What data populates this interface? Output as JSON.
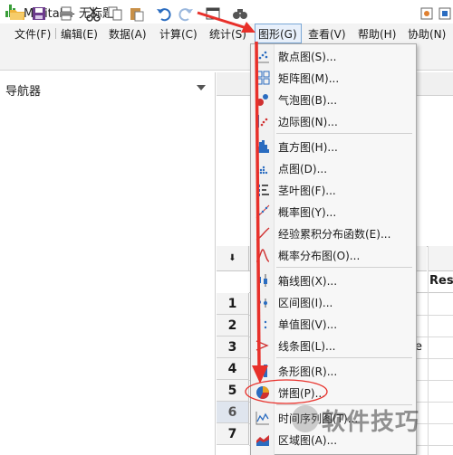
{
  "window": {
    "title": "Minitab - 无标题"
  },
  "menubar": {
    "items": [
      "文件(F)",
      "编辑(E)",
      "数据(A)",
      "计算(C)",
      "统计(S)",
      "图形(G)",
      "查看(V)",
      "帮助(H)",
      "协助(N)"
    ]
  },
  "navigator": {
    "title": "导航器"
  },
  "graph_menu": {
    "items": [
      {
        "label": "散点图(S)...",
        "icon": "scatterplot-icon"
      },
      {
        "label": "矩阵图(M)...",
        "icon": "matrix-plot-icon"
      },
      {
        "label": "气泡图(B)...",
        "icon": "bubble-plot-icon"
      },
      {
        "label": "边际图(N)...",
        "icon": "marginal-plot-icon"
      },
      {
        "label": "直方图(H)...",
        "icon": "histogram-icon"
      },
      {
        "label": "点图(D)...",
        "icon": "dotplot-icon"
      },
      {
        "label": "茎叶图(F)...",
        "icon": "stem-leaf-icon"
      },
      {
        "label": "概率图(Y)...",
        "icon": "probability-plot-icon"
      },
      {
        "label": "经验累积分布函数(E)...",
        "icon": "ecdf-icon"
      },
      {
        "label": "概率分布图(O)...",
        "icon": "distribution-plot-icon"
      },
      {
        "label": "箱线图(X)...",
        "icon": "boxplot-icon"
      },
      {
        "label": "区间图(I)...",
        "icon": "interval-plot-icon"
      },
      {
        "label": "单值图(V)...",
        "icon": "individual-value-plot-icon"
      },
      {
        "label": "线条图(L)...",
        "icon": "line-plot-icon"
      },
      {
        "label": "条形图(R)...",
        "icon": "bar-chart-icon"
      },
      {
        "label": "饼图(P)...",
        "icon": "pie-chart-icon"
      },
      {
        "label": "时间序列图(T)...",
        "icon": "time-series-icon"
      },
      {
        "label": "区域图(A)...",
        "icon": "area-graph-icon"
      }
    ]
  },
  "worksheet": {
    "rows": [
      "1",
      "2",
      "3",
      "4",
      "5",
      "6",
      "7"
    ],
    "column_name": "Resp",
    "cell_fragment": "e"
  },
  "watermark": "软件技巧",
  "colors": {
    "arrow": "#e8302a",
    "accent": "#2a6cc0",
    "app_icon": "#3a9e3a"
  }
}
